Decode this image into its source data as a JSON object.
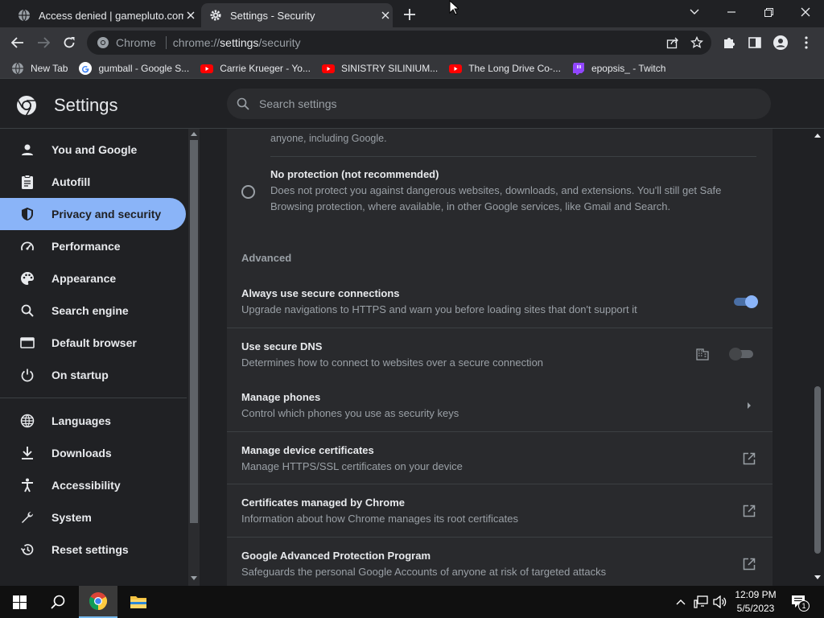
{
  "tabs": [
    {
      "title": "Access denied | gamepluto.com",
      "active": false
    },
    {
      "title": "Settings - Security",
      "active": true
    }
  ],
  "toolbar": {
    "omnibox_site": "Chrome",
    "omnibox_url_prefix": "chrome://",
    "omnibox_url_host": "settings",
    "omnibox_url_path": "/security"
  },
  "bookmarks": [
    {
      "label": "New Tab",
      "icon": "globe-icon"
    },
    {
      "label": "gumball - Google S...",
      "icon": "google-icon"
    },
    {
      "label": "Carrie Krueger - Yo...",
      "icon": "youtube-icon"
    },
    {
      "label": "SINISTRY SILINIUM...",
      "icon": "youtube-icon"
    },
    {
      "label": "The Long Drive Co-...",
      "icon": "youtube-icon"
    },
    {
      "label": "epopsis_ - Twitch",
      "icon": "twitch-icon"
    }
  ],
  "header": {
    "title": "Settings",
    "search_placeholder": "Search settings"
  },
  "sidebar": {
    "items": [
      {
        "label": "You and Google",
        "icon": "person-icon"
      },
      {
        "label": "Autofill",
        "icon": "clipboard-icon"
      },
      {
        "label": "Privacy and security",
        "icon": "shield-icon",
        "active": true
      },
      {
        "label": "Performance",
        "icon": "speedometer-icon"
      },
      {
        "label": "Appearance",
        "icon": "palette-icon"
      },
      {
        "label": "Search engine",
        "icon": "search-icon"
      },
      {
        "label": "Default browser",
        "icon": "browser-icon"
      },
      {
        "label": "On startup",
        "icon": "power-icon"
      },
      {
        "label": "Languages",
        "icon": "globe-icon"
      },
      {
        "label": "Downloads",
        "icon": "download-icon"
      },
      {
        "label": "Accessibility",
        "icon": "accessibility-icon"
      },
      {
        "label": "System",
        "icon": "wrench-icon"
      },
      {
        "label": "Reset settings",
        "icon": "history-icon"
      }
    ]
  },
  "main": {
    "partial_text": "anyone, including Google.",
    "no_protection": {
      "title": "No protection (not recommended)",
      "desc_line1": "Does not protect you against dangerous websites, downloads, and extensions. You'll still get Safe",
      "desc_line2": "Browsing protection, where available, in other Google services, like Gmail and Search.",
      "selected": false
    },
    "advanced_label": "Advanced",
    "rows": [
      {
        "title": "Always use secure connections",
        "desc": "Upgrade navigations to HTTPS and warn you before loading sites that don't support it",
        "control": "toggle",
        "on": true
      },
      {
        "title": "Use secure DNS",
        "desc": "Determines how to connect to websites over a secure connection",
        "control": "toggle",
        "on": false,
        "managed": true
      },
      {
        "title": "Manage phones",
        "desc": "Control which phones you use as security keys",
        "control": "arrow"
      },
      {
        "title": "Manage device certificates",
        "desc": "Manage HTTPS/SSL certificates on your device",
        "control": "external"
      },
      {
        "title": "Certificates managed by Chrome",
        "desc": "Information about how Chrome manages its root certificates",
        "control": "external"
      },
      {
        "title": "Google Advanced Protection Program",
        "desc": "Safeguards the personal Google Accounts of anyone at risk of targeted attacks",
        "control": "external"
      }
    ]
  },
  "taskbar": {
    "time": "12:09 PM",
    "date": "5/5/2023",
    "notification_count": "1"
  },
  "colors": {
    "accent": "#8ab4f8",
    "toggle_on_track": "#4a6fa5",
    "background": "#202124",
    "card": "#292a2d"
  }
}
